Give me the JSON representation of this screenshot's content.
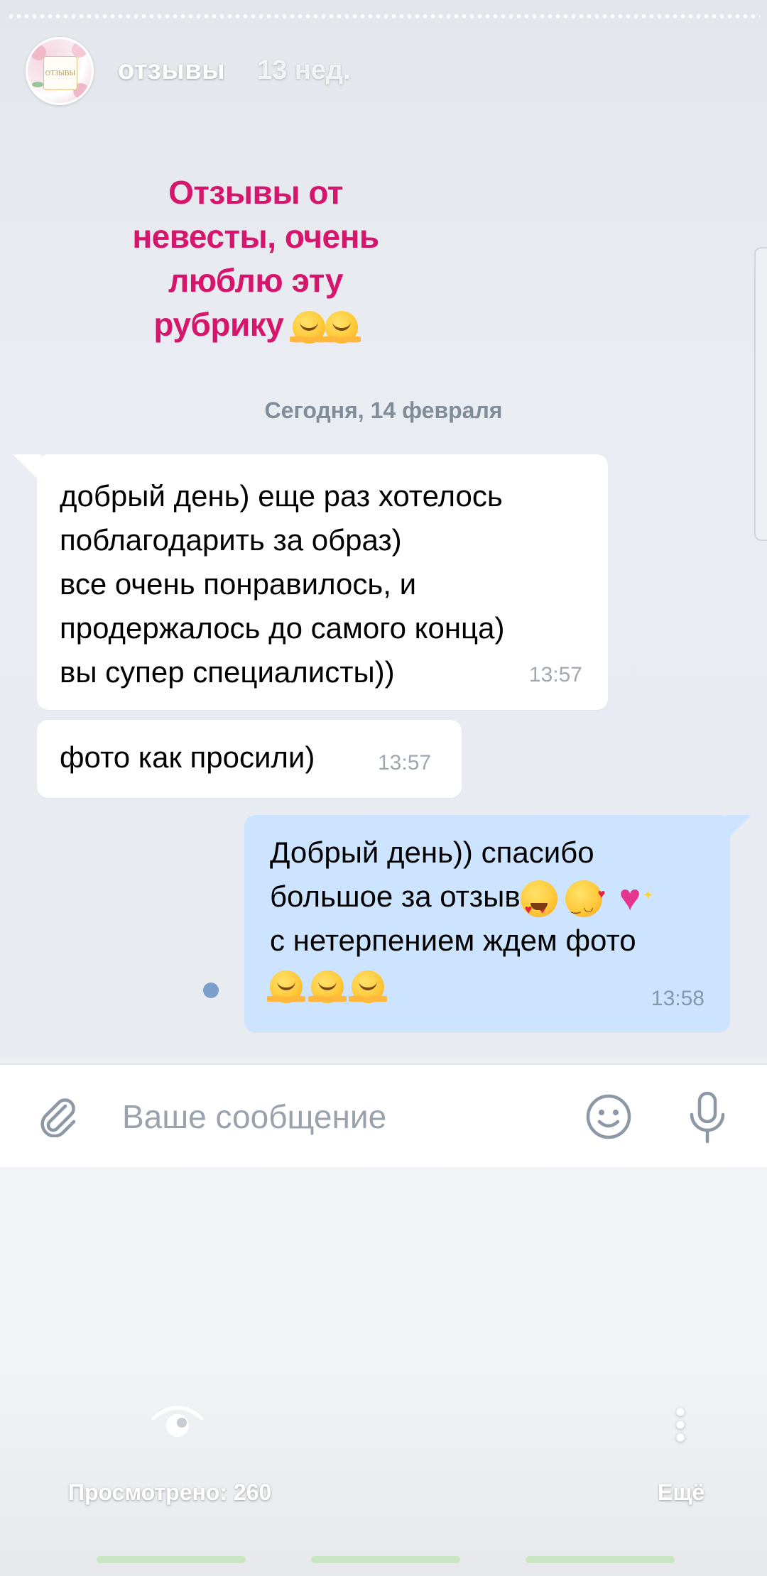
{
  "story": {
    "author": "отзывы",
    "age": "13 нед.",
    "avatar_label": "ОТЗЫВЫ"
  },
  "caption": {
    "lines": [
      "Отзывы от",
      "невесты, очень",
      "люблю эту",
      "рубрику"
    ],
    "emoji": [
      "hugging-face-emoji",
      "hugging-face-emoji"
    ]
  },
  "chat": {
    "date_separator": "Сегодня, 14 февраля",
    "messages": [
      {
        "direction": "incoming",
        "text": "добрый день) еще раз хотелось\nпоблагодарить за образ)\nвсе очень понравилось, и\nпродержалось до самого конца)\nвы супер специалисты))",
        "time": "13:57"
      },
      {
        "direction": "incoming",
        "text": "фото как просили)",
        "time": "13:57"
      },
      {
        "direction": "outgoing",
        "lines": [
          "Добрый день)) спасибо",
          "большое за отзыв",
          "с нетерпением ждем фото"
        ],
        "emoji": [
          "heart-eyes-emoji",
          "kiss-emoji",
          "sparkling-heart-emoji",
          "hugging-face-emoji",
          "hugging-face-emoji",
          "hugging-face-emoji"
        ],
        "time": "13:58",
        "status": "unread"
      }
    ]
  },
  "composer": {
    "placeholder": "Ваше сообщение",
    "icons": [
      "paperclip-icon",
      "emoji-smile-icon",
      "microphone-icon"
    ]
  },
  "footer": {
    "views_label": "Просмотрено: 260",
    "more_label": "Ещё",
    "icons": [
      "eye-icon",
      "more-vertical-icon"
    ]
  },
  "colors": {
    "caption": "#d6156c",
    "outgoing_bubble": "#cce4ff",
    "incoming_bubble": "#ffffff",
    "date_text": "#818c99",
    "unread_dot": "#7b9fcc"
  }
}
